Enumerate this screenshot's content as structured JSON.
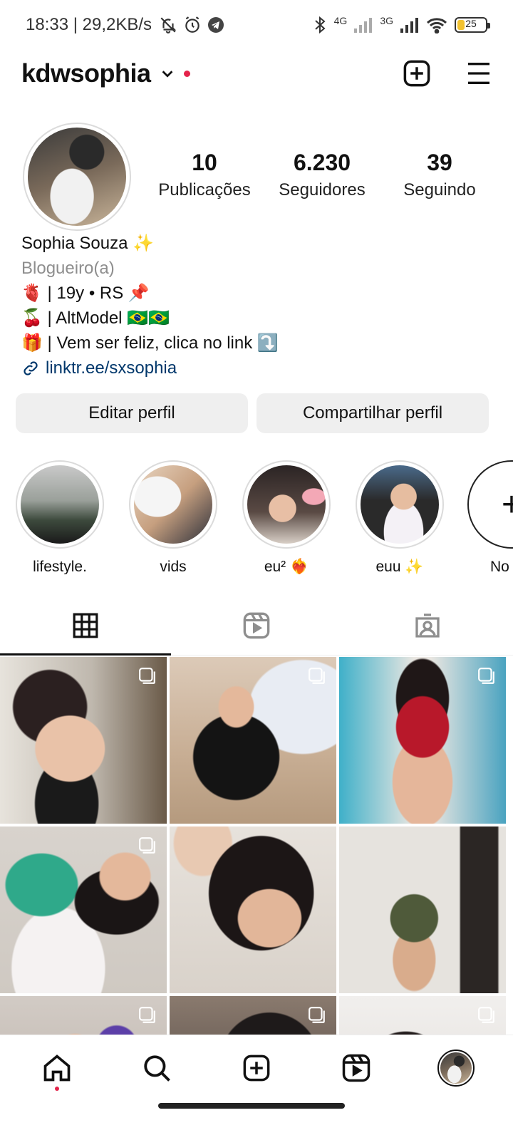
{
  "status_bar": {
    "time": "18:33 | 29,2KB/s",
    "network_1": "4G",
    "network_2": "3G",
    "battery": "25",
    "battery_level": 0.25,
    "icons": [
      "mute-icon",
      "alarm-icon",
      "telegram-icon",
      "bluetooth-icon",
      "signal-icon",
      "wifi-icon",
      "battery-icon"
    ]
  },
  "header": {
    "username": "kdwsophia",
    "icons": [
      "chevron-down-icon",
      "new-post-icon",
      "menu-icon"
    ]
  },
  "profile": {
    "stats": [
      {
        "value": "10",
        "label": "Publicações"
      },
      {
        "value": "6.230",
        "label": "Seguidores"
      },
      {
        "value": "39",
        "label": "Seguindo"
      }
    ],
    "bio": {
      "name": "Sophia Souza ✨",
      "category": "Blogueiro(a)",
      "lines": [
        "🫀 | 19y • RS 📌",
        "🍒 | AltModel 🇧🇷🇧🇷",
        "🎁 | Vem ser feliz, clica no link ⤵️"
      ],
      "link": "linktr.ee/sxsophia"
    }
  },
  "buttons": {
    "edit": "Editar perfil",
    "share": "Compartilhar perfil"
  },
  "highlights": [
    {
      "label": "lifestyle."
    },
    {
      "label": "vids"
    },
    {
      "label": "eu² ❤️‍🔥"
    },
    {
      "label": "euu ✨"
    },
    {
      "label": "No"
    }
  ],
  "tabs": [
    "grid-icon",
    "reels-icon",
    "tagged-icon"
  ],
  "bottom_nav": [
    "home-icon",
    "search-icon",
    "create-icon",
    "reels-icon",
    "profile-avatar"
  ],
  "colors": {
    "accent_red": "#e4234a",
    "link": "#00376b",
    "button_bg": "#efefef",
    "battery": "#f2c230"
  }
}
